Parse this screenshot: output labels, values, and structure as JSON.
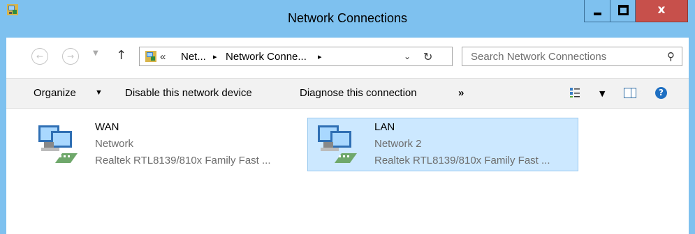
{
  "window": {
    "title": "Network Connections",
    "accent_color": "#7ec1ef",
    "close_color": "#c7504b",
    "minimize_glyph": "minimize-icon",
    "maximize_glyph": "maximize-icon",
    "close_glyph": "x"
  },
  "address_bar": {
    "overflow": "«",
    "crumbs": [
      "Net...",
      "Network Conne..."
    ],
    "separator": "▸",
    "search_placeholder": "Search Network Connections"
  },
  "toolbar": {
    "organize_label": "Organize",
    "organize_arrow": "▼",
    "disable_label": "Disable this network device",
    "diagnose_label": "Diagnose this connection",
    "more_label": "»",
    "view_dropdown_arrow": "▼",
    "help_label": "?"
  },
  "connections": [
    {
      "name": "WAN",
      "network": "Network",
      "device": "Realtek RTL8139/810x Family Fast ...",
      "selected": false
    },
    {
      "name": "LAN",
      "network": "Network  2",
      "device": "Realtek RTL8139/810x Family Fast ...",
      "selected": true,
      "selection_color": "#cce8ff"
    }
  ]
}
